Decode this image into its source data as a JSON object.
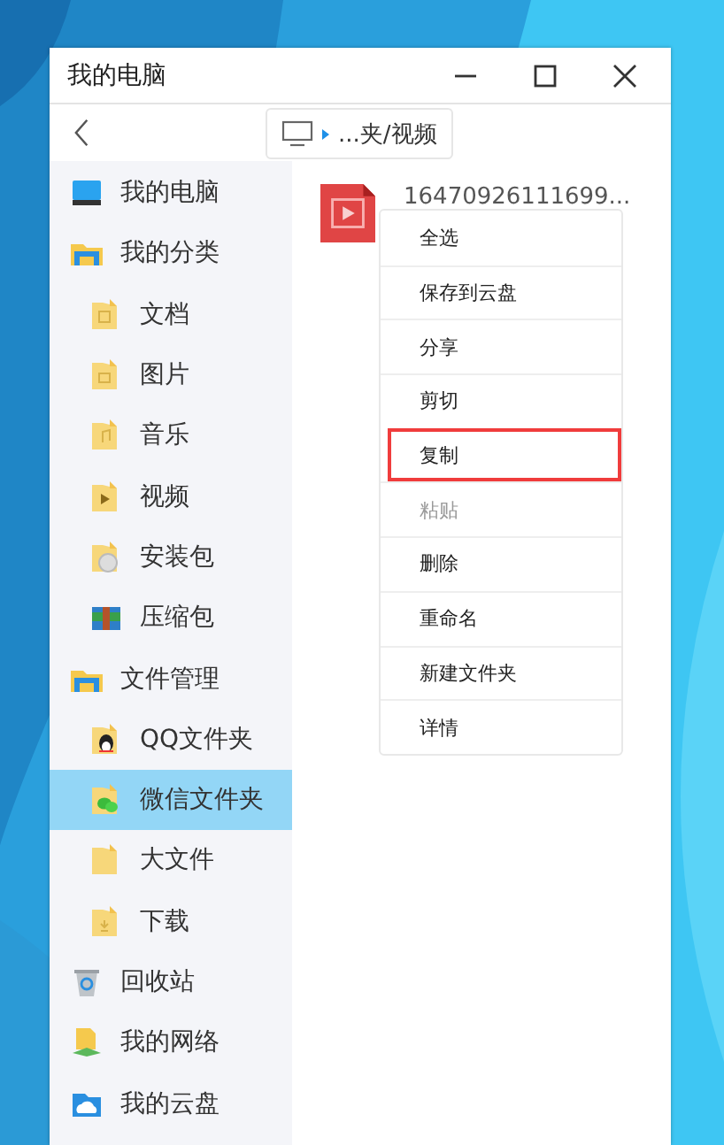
{
  "window": {
    "title": "我的电脑"
  },
  "path": {
    "text": "...夹/视频"
  },
  "sidebar": {
    "items": [
      {
        "label": "我的电脑",
        "selected": false
      },
      {
        "label": "我的分类",
        "selected": false,
        "children": [
          {
            "label": "文档",
            "selected": false
          },
          {
            "label": "图片",
            "selected": false
          },
          {
            "label": "音乐",
            "selected": false
          },
          {
            "label": "视频",
            "selected": false
          },
          {
            "label": "安装包",
            "selected": false
          },
          {
            "label": "压缩包",
            "selected": false
          }
        ]
      },
      {
        "label": "文件管理",
        "selected": false,
        "children": [
          {
            "label": "QQ文件夹",
            "selected": false
          },
          {
            "label": "微信文件夹",
            "selected": true
          },
          {
            "label": "大文件",
            "selected": false
          },
          {
            "label": "下载",
            "selected": false
          }
        ]
      },
      {
        "label": "回收站",
        "selected": false
      },
      {
        "label": "我的网络",
        "selected": false
      },
      {
        "label": "我的云盘",
        "selected": false
      }
    ]
  },
  "files": [
    {
      "name": "16470926111699..."
    }
  ],
  "context_menu": {
    "items": [
      {
        "label": "全选",
        "disabled": false,
        "highlighted": false
      },
      {
        "label": "保存到云盘",
        "disabled": false,
        "highlighted": false
      },
      {
        "label": "分享",
        "disabled": false,
        "highlighted": false
      },
      {
        "label": "剪切",
        "disabled": false,
        "highlighted": false
      },
      {
        "label": "复制",
        "disabled": false,
        "highlighted": true
      },
      {
        "label": "粘贴",
        "disabled": true,
        "highlighted": false
      },
      {
        "label": "删除",
        "disabled": false,
        "highlighted": false
      },
      {
        "label": "重命名",
        "disabled": false,
        "highlighted": false
      },
      {
        "label": "新建文件夹",
        "disabled": false,
        "highlighted": false
      },
      {
        "label": "详情",
        "disabled": false,
        "highlighted": false
      }
    ]
  }
}
